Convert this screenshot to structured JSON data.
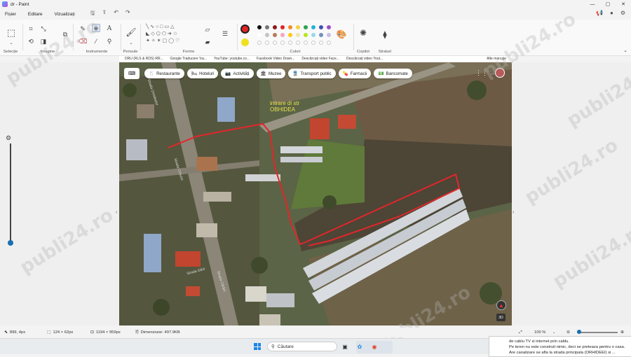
{
  "window": {
    "title": "dr - Paint",
    "controls": [
      "—",
      "▢",
      "✕"
    ],
    "right_icons": [
      "megaphone-icon",
      "avatar-icon",
      "settings-icon"
    ]
  },
  "menu": {
    "items": [
      "Fișier",
      "Editare",
      "Vizualizați"
    ]
  },
  "ribbon": {
    "groups": {
      "selection": "Selecție",
      "image": "Imagine",
      "tools": "Instrumente",
      "brushes": "Pensule",
      "shapes": "Forme",
      "colors": "Culori",
      "copilot": "Copilot",
      "layers": "Straturi"
    },
    "selected_color_primary": "#e02525",
    "selected_color_secondary": "#f1e020",
    "palette_row1": [
      "#111111",
      "#777777",
      "#8a1a1a",
      "#e02525",
      "#f28c28",
      "#f6d33c",
      "#2ea44f",
      "#23b5d3",
      "#3f51b5",
      "#9c4dcc"
    ],
    "palette_row2": [
      "#ffffff",
      "#c3c3c3",
      "#b97a57",
      "#f4a7b9",
      "#ffc90e",
      "#efe4b0",
      "#b5e61d",
      "#99d9ea",
      "#7092be",
      "#c8bfe7"
    ]
  },
  "browser_bookmarks": {
    "items": [
      "DRU (RLS & RDS) RR...",
      "Google Traducere 'tra...",
      "YouTube: youtube.co...",
      "Facebook Video Down...",
      "Descărcați video Face...",
      "Descărcați video Yout..."
    ],
    "right": "Alte marcaje"
  },
  "map": {
    "filter_chips": [
      {
        "icon": "restaurant-icon",
        "glyph": "🍴",
        "label": "Restaurante"
      },
      {
        "icon": "hotel-icon",
        "glyph": "🛏",
        "label": "Hoteluri"
      },
      {
        "icon": "camera-icon",
        "glyph": "📷",
        "label": "Activități"
      },
      {
        "icon": "museum-icon",
        "glyph": "🏛",
        "label": "Muzee"
      },
      {
        "icon": "transit-icon",
        "glyph": "🚆",
        "label": "Transport public"
      },
      {
        "icon": "pharmacy-icon",
        "glyph": "💊",
        "label": "Farmacii"
      },
      {
        "icon": "atm-icon",
        "glyph": "💵",
        "label": "Bancomate"
      }
    ],
    "annotation_line1": "intrare di str",
    "annotation_line2": "OBHIDEA",
    "streets": [
      "Strada Orhideelor",
      "Strada Crinului",
      "Strada Gării",
      "Strada Cărării"
    ],
    "view_3d": "3D"
  },
  "watermark": "publi24.ro",
  "status": {
    "cursor": "899, 4px",
    "selection_size": "124 × 62px",
    "canvas_size": "1194 × 959px",
    "file_size": "Dimensiune: 497.9KB",
    "zoom": "100 %",
    "zoom_level": 0.06
  },
  "taskbar": {
    "search_placeholder": "Căutare"
  },
  "notification": {
    "line1": "de cablu TV si internet prin cablu.",
    "line2": "Pe teren nu este construit nimic, deci se preteaza pentru o casa.",
    "line3": "Are canalizare se afla la strada principala (ORHIDEEI) si ..."
  }
}
